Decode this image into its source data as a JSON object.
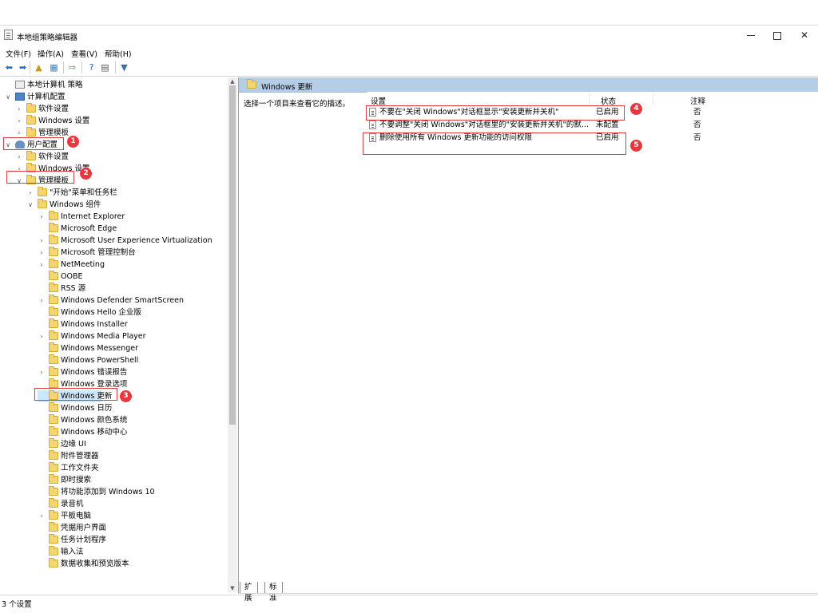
{
  "window": {
    "title": "本地组策略编辑器"
  },
  "menu": [
    "文件(F)",
    "操作(A)",
    "查看(V)",
    "帮助(H)"
  ],
  "toolbar": [
    {
      "icon": "back-arrow-icon",
      "glyph": "⬅"
    },
    {
      "icon": "forward-arrow-icon",
      "glyph": "➡"
    },
    {
      "icon": "up-folder-icon",
      "glyph": "▲"
    },
    {
      "icon": "show-hide-tree-icon",
      "glyph": "▦"
    },
    {
      "icon": "export-list-icon",
      "glyph": "⇨"
    },
    {
      "icon": "help-icon",
      "glyph": "?"
    },
    {
      "icon": "properties-icon",
      "glyph": "▤"
    },
    {
      "icon": "filter-icon",
      "glyph": "▼"
    }
  ],
  "tree": [
    {
      "label": "本地计算机 策略",
      "level": 0,
      "exp": "",
      "icon": "computer-policy"
    },
    {
      "label": "计算机配置",
      "level": 0,
      "exp": "∨",
      "icon": "computer"
    },
    {
      "label": "软件设置",
      "level": 1,
      "exp": "›",
      "icon": "folder"
    },
    {
      "label": "Windows 设置",
      "level": 1,
      "exp": "›",
      "icon": "folder"
    },
    {
      "label": "管理模板",
      "level": 1,
      "exp": "›",
      "icon": "folder"
    },
    {
      "label": "用户配置",
      "level": 0,
      "exp": "∨",
      "icon": "user"
    },
    {
      "label": "软件设置",
      "level": 1,
      "exp": "›",
      "icon": "folder"
    },
    {
      "label": "Windows 设置",
      "level": 1,
      "exp": "›",
      "icon": "folder"
    },
    {
      "label": "管理模板",
      "level": 1,
      "exp": "∨",
      "icon": "folder"
    },
    {
      "label": "\"开始\"菜单和任务栏",
      "level": 2,
      "exp": "›",
      "icon": "folder"
    },
    {
      "label": "Windows 组件",
      "level": 2,
      "exp": "∨",
      "icon": "folder"
    },
    {
      "label": "Internet Explorer",
      "level": 3,
      "exp": "›",
      "icon": "folder"
    },
    {
      "label": "Microsoft Edge",
      "level": 3,
      "exp": "",
      "icon": "folder"
    },
    {
      "label": "Microsoft User Experience Virtualization",
      "level": 3,
      "exp": "›",
      "icon": "folder"
    },
    {
      "label": "Microsoft 管理控制台",
      "level": 3,
      "exp": "›",
      "icon": "folder"
    },
    {
      "label": "NetMeeting",
      "level": 3,
      "exp": "›",
      "icon": "folder"
    },
    {
      "label": "OOBE",
      "level": 3,
      "exp": "",
      "icon": "folder"
    },
    {
      "label": "RSS 源",
      "level": 3,
      "exp": "",
      "icon": "folder"
    },
    {
      "label": "Windows Defender SmartScreen",
      "level": 3,
      "exp": "›",
      "icon": "folder"
    },
    {
      "label": "Windows Hello 企业版",
      "level": 3,
      "exp": "",
      "icon": "folder"
    },
    {
      "label": "Windows Installer",
      "level": 3,
      "exp": "",
      "icon": "folder"
    },
    {
      "label": "Windows Media Player",
      "level": 3,
      "exp": "›",
      "icon": "folder"
    },
    {
      "label": "Windows Messenger",
      "level": 3,
      "exp": "",
      "icon": "folder"
    },
    {
      "label": "Windows PowerShell",
      "level": 3,
      "exp": "",
      "icon": "folder"
    },
    {
      "label": "Windows 错误报告",
      "level": 3,
      "exp": "›",
      "icon": "folder"
    },
    {
      "label": "Windows 登录选项",
      "level": 3,
      "exp": "",
      "icon": "folder"
    },
    {
      "label": "Windows 更新",
      "level": 3,
      "exp": "",
      "icon": "folder",
      "selected": true
    },
    {
      "label": "Windows 日历",
      "level": 3,
      "exp": "",
      "icon": "folder"
    },
    {
      "label": "Windows 颜色系统",
      "level": 3,
      "exp": "",
      "icon": "folder"
    },
    {
      "label": "Windows 移动中心",
      "level": 3,
      "exp": "",
      "icon": "folder"
    },
    {
      "label": "边缘 UI",
      "level": 3,
      "exp": "",
      "icon": "folder"
    },
    {
      "label": "附件管理器",
      "level": 3,
      "exp": "",
      "icon": "folder"
    },
    {
      "label": "工作文件夹",
      "level": 3,
      "exp": "",
      "icon": "folder"
    },
    {
      "label": "即时搜索",
      "level": 3,
      "exp": "",
      "icon": "folder"
    },
    {
      "label": "将功能添加到 Windows 10",
      "level": 3,
      "exp": "",
      "icon": "folder"
    },
    {
      "label": "录音机",
      "level": 3,
      "exp": "",
      "icon": "folder"
    },
    {
      "label": "平板电脑",
      "level": 3,
      "exp": "›",
      "icon": "folder"
    },
    {
      "label": "凭据用户界面",
      "level": 3,
      "exp": "",
      "icon": "folder"
    },
    {
      "label": "任务计划程序",
      "level": 3,
      "exp": "",
      "icon": "folder"
    },
    {
      "label": "输入法",
      "level": 3,
      "exp": "",
      "icon": "folder"
    },
    {
      "label": "数据收集和预览版本",
      "level": 3,
      "exp": "",
      "icon": "folder"
    }
  ],
  "right": {
    "header": "Windows 更新",
    "description": "选择一个项目来查看它的描述。",
    "columns": {
      "setting": "设置",
      "state": "状态",
      "comment": "注释"
    },
    "rows": [
      {
        "setting": "不要在\"关闭 Windows\"对话框显示\"安装更新并关机\"",
        "state": "已启用",
        "comment": "否"
      },
      {
        "setting": "不要调整\"关闭 Windows\"对话框里的\"安装更新并关机\"的默...",
        "state": "未配置",
        "comment": "否"
      },
      {
        "setting": "删除使用所有 Windows 更新功能的访问权限",
        "state": "已启用",
        "comment": "否"
      }
    ]
  },
  "tabs": [
    "扩展",
    "标准"
  ],
  "status": "3 个设置",
  "annotations": [
    "1",
    "2",
    "3",
    "4",
    "5"
  ],
  "colors": {
    "accent": "#e2393c",
    "header": "#b6cde6",
    "selection": "#cce8ff",
    "folder": "#f5d472"
  }
}
